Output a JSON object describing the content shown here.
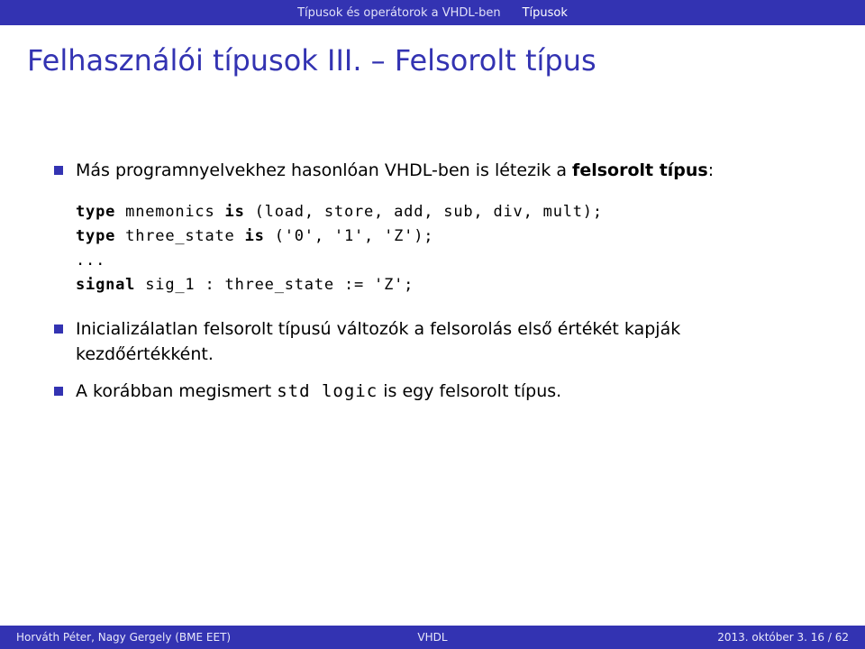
{
  "topbar": {
    "section": "Típusok és operátorok a VHDL-ben",
    "subsection": "Típusok"
  },
  "title": "Felhasználói típusok III. – Felsorolt típus",
  "bullets": {
    "b1_pre": "Más programnyelvekhez hasonlóan VHDL-ben is létezik a ",
    "b1_bold": "felsorolt típus",
    "b1_post": ":",
    "b2": "Inicializálatlan felsorolt típusú változók a felsorolás első értékét kapják kezdőértékként.",
    "b3_pre": "A korábban megismert ",
    "b3_code": "std logic",
    "b3_post": " is egy felsorolt típus."
  },
  "code": {
    "l1a": "type",
    "l1b": " mnemonics ",
    "l1c": "is",
    "l1d": " (load, store, add, sub, div, mult);",
    "l2a": "type",
    "l2b": " three_state ",
    "l2c": "is",
    "l2d": " ('0', '1', 'Z');",
    "l3": "...",
    "l4a": "signal",
    "l4b": " sig_1 : three_state := 'Z';"
  },
  "footer": {
    "left": "Horváth Péter, Nagy Gergely (BME EET)",
    "mid": "VHDL",
    "right": "2013. október 3.      16 / 62"
  }
}
